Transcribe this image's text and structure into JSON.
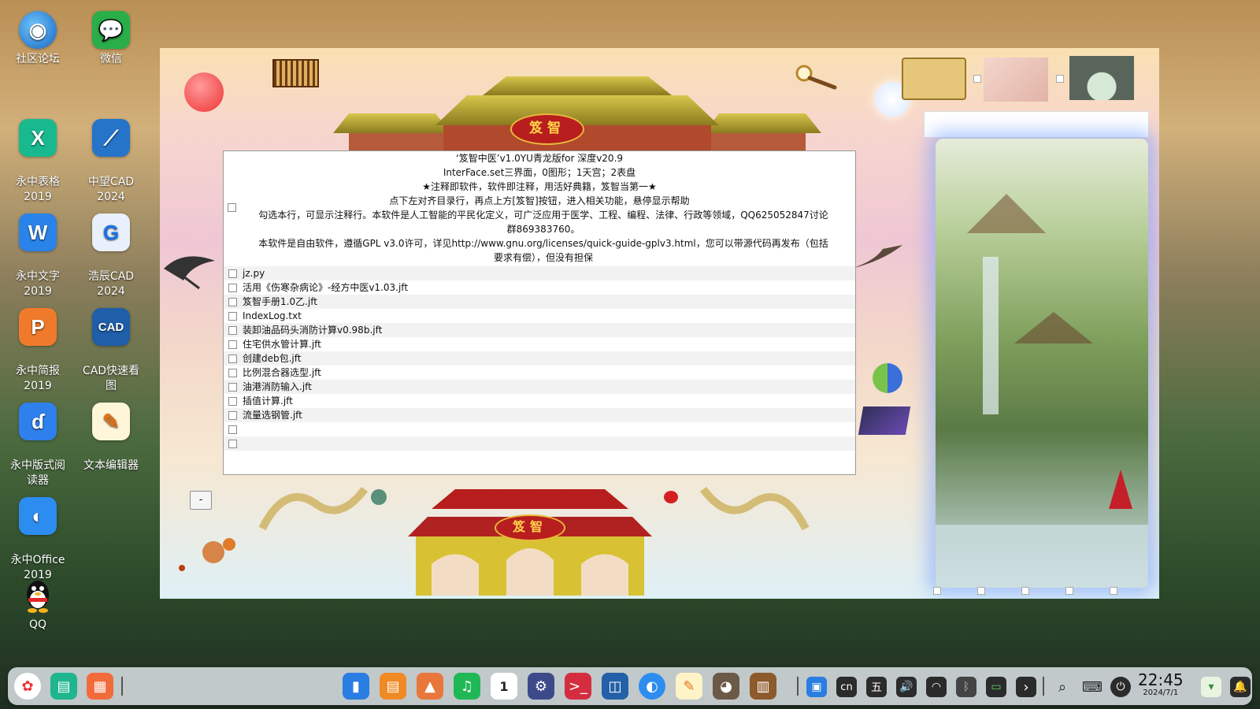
{
  "desktop_icons": [
    {
      "label": "社区论坛",
      "icon": "deepin-forum-icon",
      "color": "#1e88e5"
    },
    {
      "label": "微信",
      "icon": "wechat-icon",
      "color": "#2aae4a"
    },
    {
      "label": "永中表格\n2019",
      "icon": "yozo-sheet-icon",
      "color": "#19b98f"
    },
    {
      "label": "中望CAD\n2024",
      "icon": "zwcad-icon",
      "color": "#2574c9"
    },
    {
      "label": "永中文字\n2019",
      "icon": "yozo-writer-icon",
      "color": "#2a83e8"
    },
    {
      "label": "浩辰CAD\n2024",
      "icon": "gstarcad-icon",
      "color": "#e8f0fb"
    },
    {
      "label": "永中简报\n2019",
      "icon": "yozo-presentation-icon",
      "color": "#f07a2b"
    },
    {
      "label": "CAD快速看\n图",
      "icon": "cad-viewer-icon",
      "color": "#1f5ea8"
    },
    {
      "label": "永中版式阅\n读器",
      "icon": "yozo-reader-icon",
      "color": "#2f80ed"
    },
    {
      "label": "文本编辑器",
      "icon": "text-editor-icon",
      "color": "#fff6d9"
    },
    {
      "label": "永中Office\n2019",
      "icon": "yozo-office-icon",
      "color": "#2d8cf0"
    },
    {
      "label": "QQ",
      "icon": "qq-icon",
      "color": "#111111"
    }
  ],
  "app": {
    "palace_sign_top": "笈智",
    "palace_sign_bottom": "笈智",
    "header_lines": [
      "‘笈智中医’v1.0YU青龙版for 深度v20.9",
      "InterFace.set三界面，0图形；1天宫；2表盘",
      "★注释即软件，软件即注释，用活好典籍，笈智当第一★",
      "点下左对齐目录行，再点上方[笈智]按钮，进入相关功能，悬停显示帮助",
      "勾选本行，可显示注释行。本软件是人工智能的平民化定义，可广泛应用于医学、工程、编程、法律、行政等领域，QQ625052847讨论群869383760。",
      "本软件是自由软件，遵循GPL v3.0许可，详见http://www.gnu.org/licenses/quick-guide-gplv3.html，您可以带源代码再发布（包括要求有偿），但没有担保"
    ],
    "files": [
      "jz.py",
      "活用《伤寒杂病论》-经方中医v1.03.jft",
      "笈智手册1.0乙.jft",
      "IndexLog.txt",
      "装卸油品码头消防计算v0.98b.jft",
      "住宅供水管计算.jft",
      "创建deb包.jft",
      "比例混合器选型.jft",
      "油港消防输入.jft",
      "插值计算.jft",
      "流量选钢管.jft",
      "",
      ""
    ],
    "small_button_label": "-",
    "search_placeholder": ""
  },
  "taskbar": {
    "apps": [
      {
        "icon": "launcher-icon",
        "color": "#ffffff"
      },
      {
        "icon": "multitask-view-icon",
        "color": "#1fb58f"
      },
      {
        "icon": "show-desktop-icon",
        "color": "#f26b3a"
      },
      {
        "icon": "file-manager-icon",
        "color": "#2a7de1"
      },
      {
        "icon": "app-store-icon",
        "color": "#f08a24"
      },
      {
        "icon": "image-viewer-icon",
        "color": "#e9773b"
      },
      {
        "icon": "music-icon",
        "color": "#1fb855"
      },
      {
        "icon": "calendar-icon",
        "color": "#ffffff"
      },
      {
        "icon": "control-center-icon",
        "color": "#3d4a8a"
      },
      {
        "icon": "terminal-icon",
        "color": "#d42d3f"
      },
      {
        "icon": "virtualbox-icon",
        "color": "#2360a8"
      },
      {
        "icon": "browser-icon",
        "color": "#2d8cf0"
      },
      {
        "icon": "text-editor-icon",
        "color": "#fff4c8"
      },
      {
        "icon": "gimp-icon",
        "color": "#6b5a48"
      },
      {
        "icon": "abacus-app-icon",
        "color": "#8c5a2b"
      }
    ],
    "tray": [
      {
        "icon": "screen-share-icon",
        "text": "▣"
      },
      {
        "icon": "input-method-icon",
        "text": "cn"
      },
      {
        "icon": "wubi-icon",
        "text": "五"
      },
      {
        "icon": "volume-icon",
        "text": "🔊"
      },
      {
        "icon": "wifi-icon",
        "text": "◠"
      },
      {
        "icon": "bluetooth-icon",
        "text": "ᛒ"
      },
      {
        "icon": "battery-icon",
        "text": "▭"
      },
      {
        "icon": "expand-tray-icon",
        "text": "›"
      },
      {
        "icon": "search-icon",
        "text": "⌕"
      },
      {
        "icon": "keyboard-icon",
        "text": "⌨"
      },
      {
        "icon": "power-icon",
        "text": "⏻"
      }
    ],
    "time": "22:45",
    "date": "2024/7/1",
    "calendar_day": "1"
  }
}
